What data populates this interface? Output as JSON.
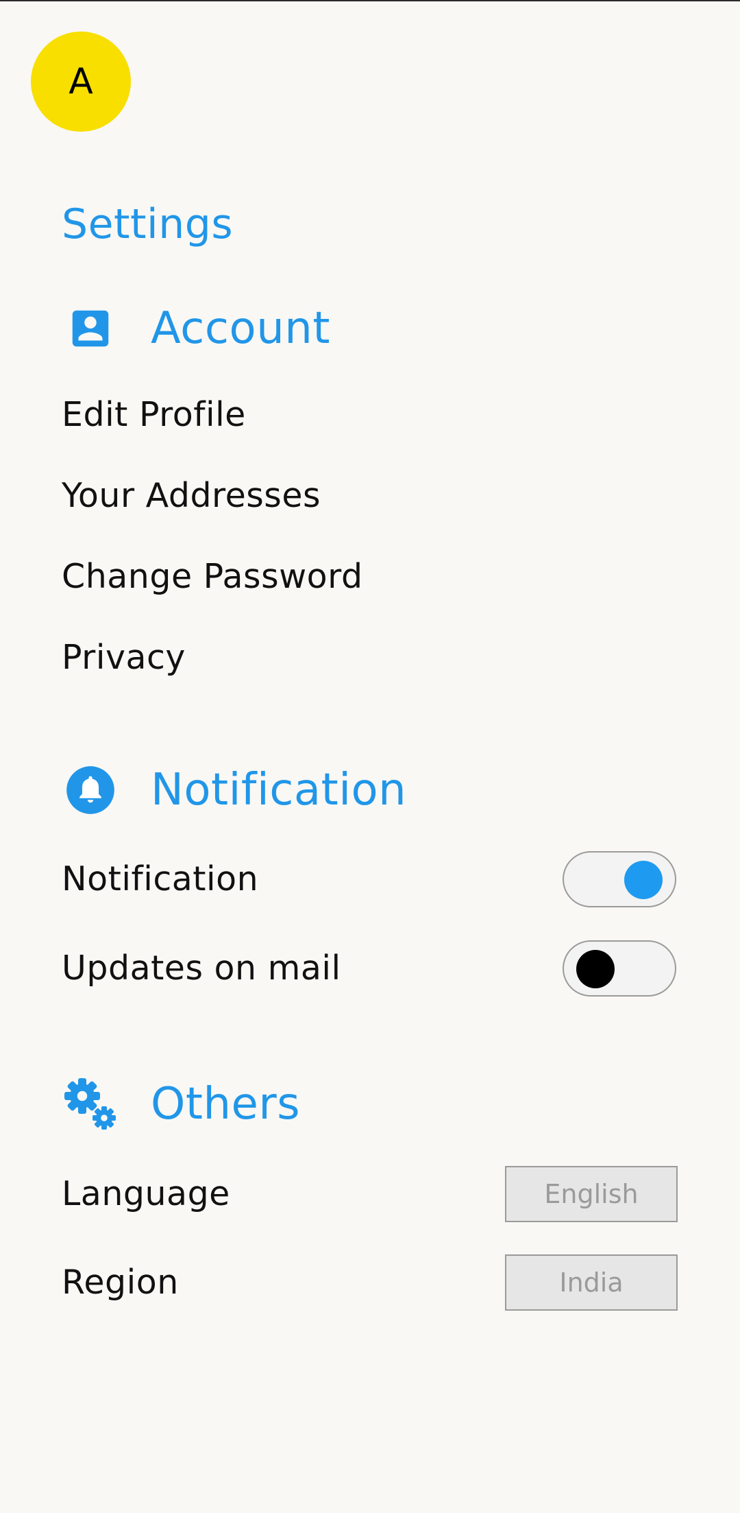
{
  "profile": {
    "avatar_initial": "A"
  },
  "page": {
    "title": "Settings"
  },
  "account": {
    "title": "Account",
    "icon": "account-box-icon",
    "items": [
      {
        "label": "Edit Profile"
      },
      {
        "label": "Your Addresses"
      },
      {
        "label": "Change Password"
      },
      {
        "label": "Privacy"
      }
    ]
  },
  "notification": {
    "title": "Notification",
    "icon": "bell-icon",
    "toggles": [
      {
        "label": "Notification",
        "on": true
      },
      {
        "label": "Updates on mail",
        "on": false
      }
    ]
  },
  "others": {
    "title": "Others",
    "icon": "gears-icon",
    "fields": [
      {
        "label": "Language",
        "value": "English"
      },
      {
        "label": "Region",
        "value": "India"
      }
    ]
  },
  "colors": {
    "accent": "#2196e8",
    "avatar_bg": "#f8df00",
    "toggle_on_knob": "#1e9bf0",
    "toggle_off_knob": "#000000",
    "background": "#f9f8f5"
  }
}
